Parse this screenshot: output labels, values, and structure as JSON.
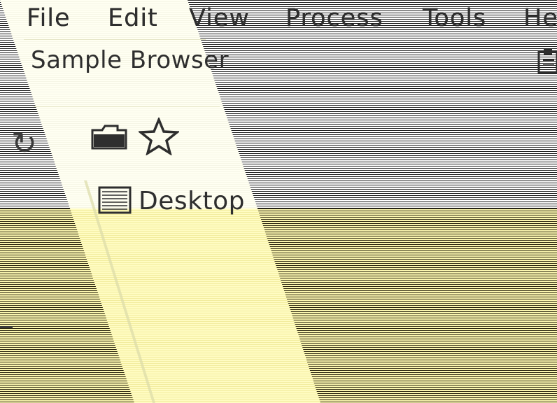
{
  "menubar": {
    "items": [
      {
        "label": "File"
      },
      {
        "label": "Edit"
      },
      {
        "label": "View"
      },
      {
        "label": "Process"
      },
      {
        "label": "Tools"
      },
      {
        "label": "He"
      }
    ]
  },
  "window": {
    "title": "Sample Browser"
  },
  "toolbar": {
    "icons": [
      "folder-icon",
      "star-icon",
      "clipboard-icon"
    ]
  },
  "places": {
    "items": [
      {
        "label": "Desktop",
        "icon": "desktop-icon"
      }
    ]
  },
  "colors": {
    "panel": "#fffff2",
    "lower_band": "#fbf6b0",
    "ink": "#2e2e2e"
  }
}
